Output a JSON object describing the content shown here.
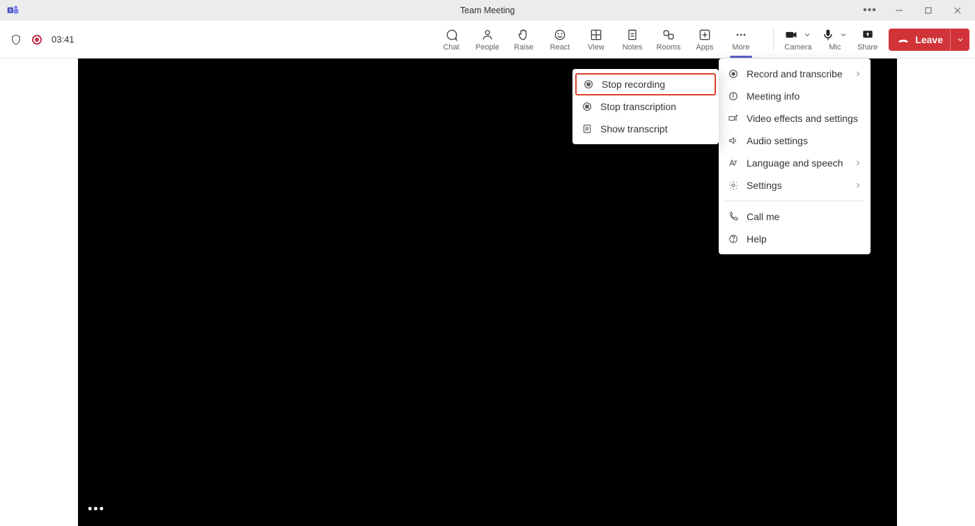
{
  "window": {
    "title": "Team Meeting"
  },
  "status": {
    "timer": "03:41"
  },
  "toolbar": {
    "chat": "Chat",
    "people": "People",
    "raise": "Raise",
    "react": "React",
    "view": "View",
    "notes": "Notes",
    "rooms": "Rooms",
    "apps": "Apps",
    "more": "More",
    "camera": "Camera",
    "mic": "Mic",
    "share": "Share",
    "leave": "Leave"
  },
  "more_menu": {
    "record_transcribe": "Record and transcribe",
    "meeting_info": "Meeting info",
    "video_effects": "Video effects and settings",
    "audio_settings": "Audio settings",
    "language_speech": "Language and speech",
    "settings": "Settings",
    "call_me": "Call me",
    "help": "Help"
  },
  "record_submenu": {
    "stop_recording": "Stop recording",
    "stop_transcription": "Stop transcription",
    "show_transcript": "Show transcript"
  }
}
